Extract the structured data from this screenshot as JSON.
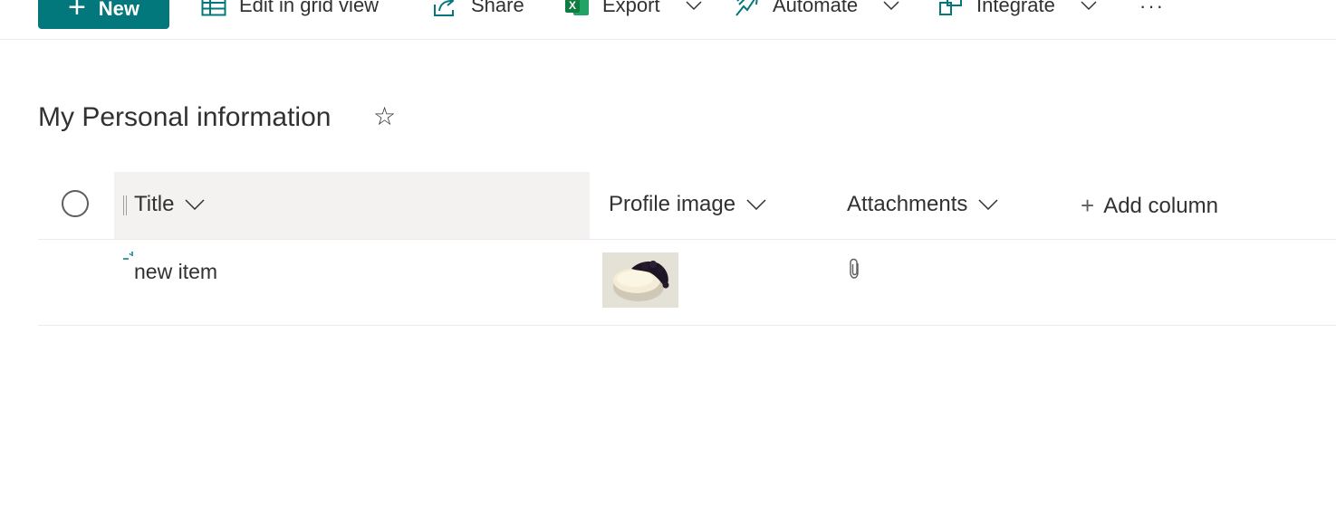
{
  "toolbar": {
    "new_label": "New",
    "grid_label": "Edit in grid view",
    "share_label": "Share",
    "export_label": "Export",
    "automate_label": "Automate",
    "integrate_label": "Integrate",
    "more_label": "···"
  },
  "list": {
    "title": "My Personal information",
    "favorite_glyph": "☆",
    "columns": [
      {
        "label": "Title"
      },
      {
        "label": "Profile image"
      },
      {
        "label": "Attachments"
      }
    ],
    "add_column_label": "Add column",
    "add_column_glyph": "+",
    "rows": [
      {
        "title": "new item"
      }
    ]
  },
  "colors": {
    "accent": "#03787c",
    "header_selected_bg": "#f3f2f1",
    "divider": "#edebe9",
    "text": "#323130"
  },
  "icons": [
    "plus-icon",
    "grid-icon",
    "share-icon",
    "excel-icon",
    "automate-icon",
    "integrate-icon",
    "chevron-down-icon",
    "more-icon",
    "star-icon",
    "paperclip-icon",
    "spinner-icon"
  ]
}
